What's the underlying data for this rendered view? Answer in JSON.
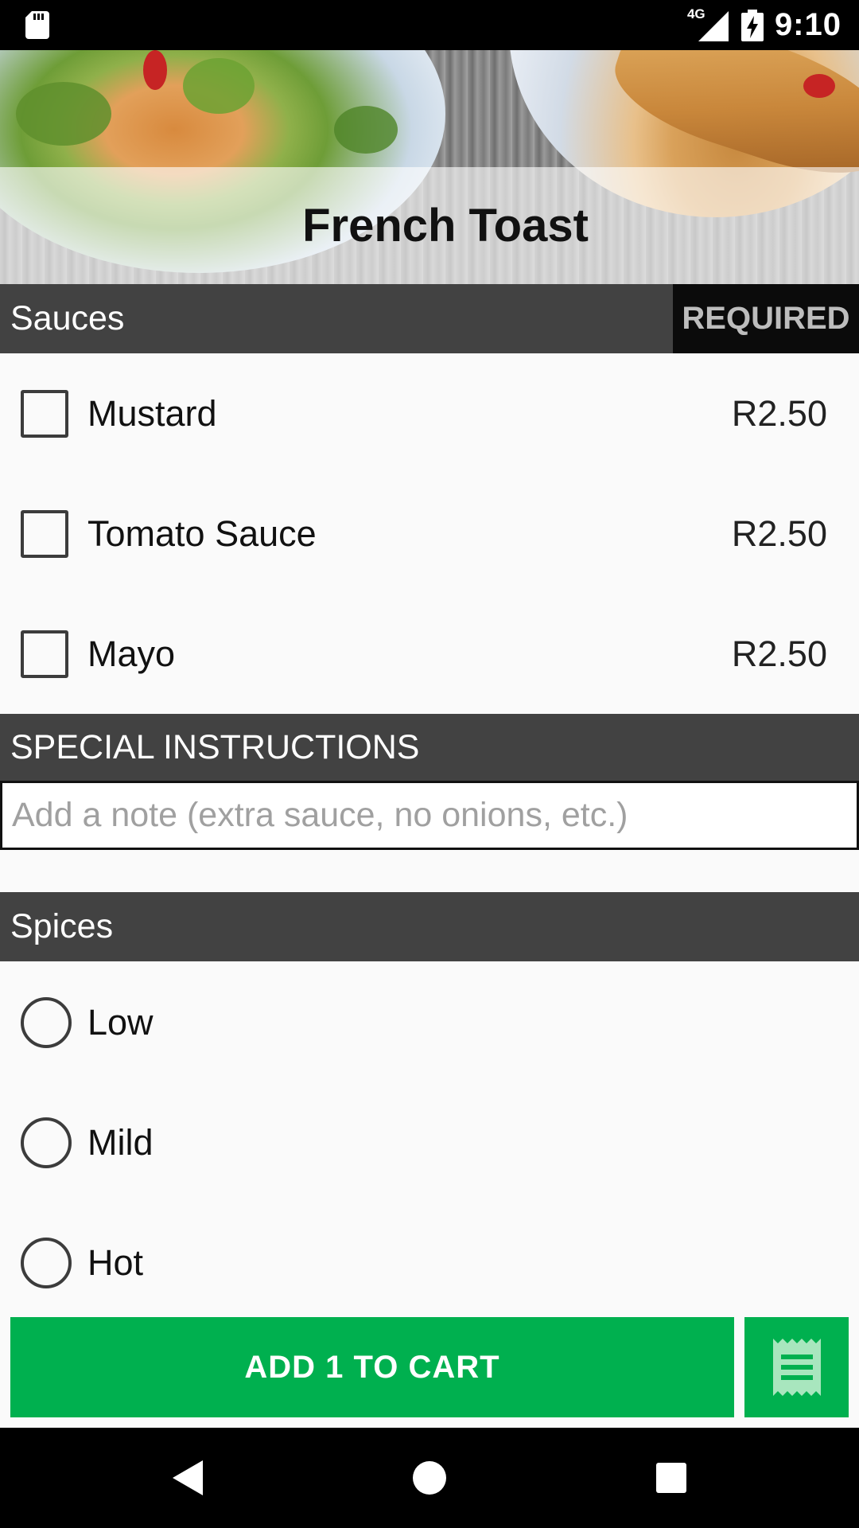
{
  "status_bar": {
    "time": "9:10",
    "network": "4G",
    "icons": [
      "sd-card-icon",
      "signal-icon",
      "battery-charging-icon"
    ]
  },
  "header": {
    "title": "French Toast"
  },
  "sauces": {
    "label": "Sauces",
    "badge": "REQUIRED",
    "items": [
      {
        "label": "Mustard",
        "price": "R2.50",
        "checked": false
      },
      {
        "label": "Tomato Sauce",
        "price": "R2.50",
        "checked": false
      },
      {
        "label": "Mayo",
        "price": "R2.50",
        "checked": false
      }
    ]
  },
  "special_instructions": {
    "label": "SPECIAL INSTRUCTIONS",
    "placeholder": "Add a note (extra sauce, no onions, etc.)",
    "value": ""
  },
  "spices": {
    "label": "Spices",
    "items": [
      {
        "label": "Low",
        "selected": false
      },
      {
        "label": "Mild",
        "selected": false
      },
      {
        "label": "Hot",
        "selected": false
      }
    ]
  },
  "cart": {
    "add_label": "ADD 1 TO CART",
    "receipt_icon": "receipt-icon"
  },
  "colors": {
    "accent": "#00b04f",
    "section_header": "#424242",
    "required_badge": "#0b0b0b"
  },
  "nav": {
    "icons": [
      "back-icon",
      "home-icon",
      "recents-icon"
    ]
  }
}
